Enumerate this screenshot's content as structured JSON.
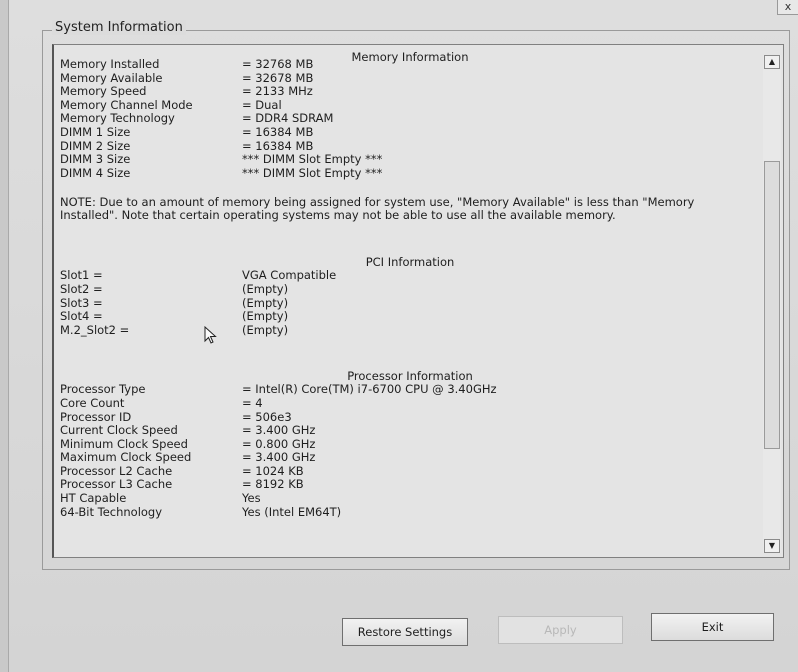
{
  "window": {
    "close_label": "x"
  },
  "group": {
    "title": "System Information"
  },
  "memory": {
    "title": "Memory Information",
    "rows": [
      {
        "key": "Memory Installed",
        "value": "= 32768 MB"
      },
      {
        "key": "Memory Available",
        "value": "= 32678 MB"
      },
      {
        "key": "Memory Speed",
        "value": "= 2133 MHz"
      },
      {
        "key": "Memory Channel Mode",
        "value": "= Dual"
      },
      {
        "key": "Memory Technology",
        "value": "= DDR4 SDRAM"
      },
      {
        "key": "DIMM 1 Size",
        "value": "= 16384 MB"
      },
      {
        "key": "DIMM 2 Size",
        "value": "= 16384 MB"
      },
      {
        "key": "DIMM 3 Size",
        "value": "*** DIMM Slot Empty ***"
      },
      {
        "key": "DIMM 4 Size",
        "value": "*** DIMM Slot Empty ***"
      }
    ],
    "note": "NOTE: Due to an amount of memory being assigned for system use, \"Memory Available\" is less than \"Memory Installed\". Note that certain operating systems may not be able to use all the available memory."
  },
  "pci": {
    "title": "PCI Information",
    "rows": [
      {
        "key": "Slot1 =",
        "value": "VGA Compatible"
      },
      {
        "key": "Slot2 =",
        "value": "(Empty)"
      },
      {
        "key": "Slot3 =",
        "value": "(Empty)"
      },
      {
        "key": "Slot4 =",
        "value": "(Empty)"
      },
      {
        "key": "M.2_Slot2 =",
        "value": "(Empty)"
      }
    ]
  },
  "processor": {
    "title": "Processor Information",
    "rows": [
      {
        "key": "Processor Type",
        "value": "= Intel(R) Core(TM) i7-6700 CPU @ 3.40GHz"
      },
      {
        "key": "Core Count",
        "value": "= 4"
      },
      {
        "key": "Processor ID",
        "value": "= 506e3"
      },
      {
        "key": "Current Clock Speed",
        "value": "= 3.400 GHz"
      },
      {
        "key": "Minimum Clock Speed",
        "value": "= 0.800 GHz"
      },
      {
        "key": "Maximum Clock Speed",
        "value": "= 3.400 GHz"
      },
      {
        "key": "Processor L2 Cache",
        "value": "= 1024 KB"
      },
      {
        "key": "Processor L3 Cache",
        "value": "= 8192 KB"
      },
      {
        "key": "HT Capable",
        "value": "Yes"
      },
      {
        "key": "64-Bit Technology",
        "value": "Yes (Intel EM64T)"
      }
    ]
  },
  "buttons": {
    "restore_label": "Restore Settings",
    "apply_label": "Apply",
    "exit_label": "Exit"
  },
  "icons": {
    "scroll_up": "chevron-up-icon",
    "scroll_down": "chevron-down-icon",
    "cursor": "mouse-pointer-icon"
  }
}
